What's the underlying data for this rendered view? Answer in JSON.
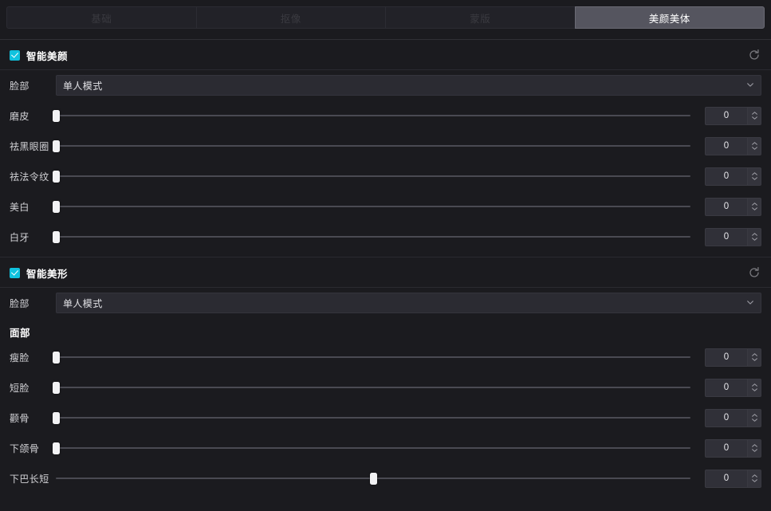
{
  "tabs": [
    {
      "label": "基础",
      "active": false
    },
    {
      "label": "抠像",
      "active": false
    },
    {
      "label": "蒙版",
      "active": false
    },
    {
      "label": "美颜美体",
      "active": true
    }
  ],
  "colors": {
    "accent": "#10c2de",
    "panel_bg": "#1b1b1f",
    "active_tab_bg": "#55555f",
    "slider_track": "#4a4a52",
    "slider_thumb": "#f2f2f4"
  },
  "sections": [
    {
      "title": "智能美颜",
      "checked": true,
      "reset_icon": "reset-circular-arrow-icon",
      "mode_label": "脸部",
      "mode_value": "单人模式",
      "mode_arrow_icon": "chevron-down-icon",
      "sliders": [
        {
          "label": "磨皮",
          "value": "0",
          "percent": 0
        },
        {
          "label": "祛黑眼圈",
          "value": "0",
          "percent": 0
        },
        {
          "label": "祛法令纹",
          "value": "0",
          "percent": 0
        },
        {
          "label": "美白",
          "value": "0",
          "percent": 0
        },
        {
          "label": "白牙",
          "value": "0",
          "percent": 0
        }
      ]
    },
    {
      "title": "智能美形",
      "checked": true,
      "reset_icon": "reset-circular-arrow-icon",
      "mode_label": "脸部",
      "mode_value": "单人模式",
      "mode_arrow_icon": "chevron-down-icon",
      "sub_head": "面部",
      "sliders": [
        {
          "label": "瘦脸",
          "value": "0",
          "percent": 0
        },
        {
          "label": "短脸",
          "value": "0",
          "percent": 0
        },
        {
          "label": "颧骨",
          "value": "0",
          "percent": 0
        },
        {
          "label": "下颌骨",
          "value": "0",
          "percent": 0
        },
        {
          "label": "下巴长短",
          "value": "0",
          "percent": 50
        }
      ]
    }
  ]
}
